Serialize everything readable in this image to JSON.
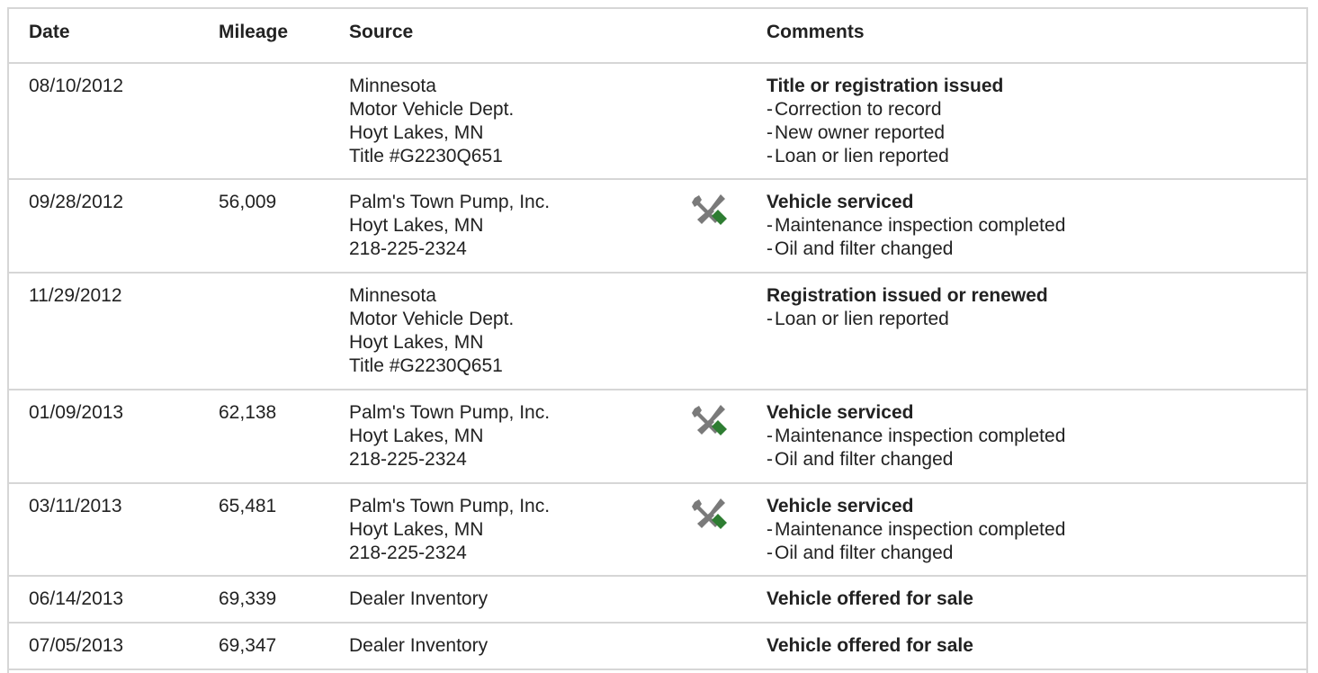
{
  "table": {
    "headers": {
      "date": "Date",
      "mileage": "Mileage",
      "source": "Source",
      "comments": "Comments"
    },
    "rows": [
      {
        "date": "08/10/2012",
        "mileage": "",
        "source": [
          "Minnesota",
          "Motor Vehicle Dept.",
          "Hoyt Lakes, MN",
          "Title #G2230Q651"
        ],
        "icon": "",
        "comment_title": "Title or registration issued",
        "comment_items": [
          "Correction to record",
          "New owner reported",
          "Loan or lien reported"
        ]
      },
      {
        "date": "09/28/2012",
        "mileage": "56,009",
        "source": [
          "Palm's Town Pump, Inc.",
          "Hoyt Lakes, MN",
          "218-225-2324"
        ],
        "icon": "wrench-screwdriver-icon",
        "comment_title": "Vehicle serviced",
        "comment_items": [
          "Maintenance inspection completed",
          "Oil and filter changed"
        ]
      },
      {
        "date": "11/29/2012",
        "mileage": "",
        "source": [
          "Minnesota",
          "Motor Vehicle Dept.",
          "Hoyt Lakes, MN",
          "Title #G2230Q651"
        ],
        "icon": "",
        "comment_title": "Registration issued or renewed",
        "comment_items": [
          "Loan or lien reported"
        ]
      },
      {
        "date": "01/09/2013",
        "mileage": "62,138",
        "source": [
          "Palm's Town Pump, Inc.",
          "Hoyt Lakes, MN",
          "218-225-2324"
        ],
        "icon": "wrench-screwdriver-icon",
        "comment_title": "Vehicle serviced",
        "comment_items": [
          "Maintenance inspection completed",
          "Oil and filter changed"
        ]
      },
      {
        "date": "03/11/2013",
        "mileage": "65,481",
        "source": [
          "Palm's Town Pump, Inc.",
          "Hoyt Lakes, MN",
          "218-225-2324"
        ],
        "icon": "wrench-screwdriver-icon",
        "comment_title": "Vehicle serviced",
        "comment_items": [
          "Maintenance inspection completed",
          "Oil and filter changed"
        ]
      },
      {
        "date": "06/14/2013",
        "mileage": "69,339",
        "source": [
          "Dealer Inventory"
        ],
        "icon": "",
        "comment_title": "Vehicle offered for sale",
        "comment_items": []
      },
      {
        "date": "07/05/2013",
        "mileage": "69,347",
        "source": [
          "Dealer Inventory"
        ],
        "icon": "",
        "comment_title": "Vehicle offered for sale",
        "comment_items": []
      }
    ]
  },
  "colors": {
    "border": "#d6d6d6",
    "text": "#222222",
    "icon_gray": "#7a7a7a",
    "icon_green": "#2e7d32"
  }
}
